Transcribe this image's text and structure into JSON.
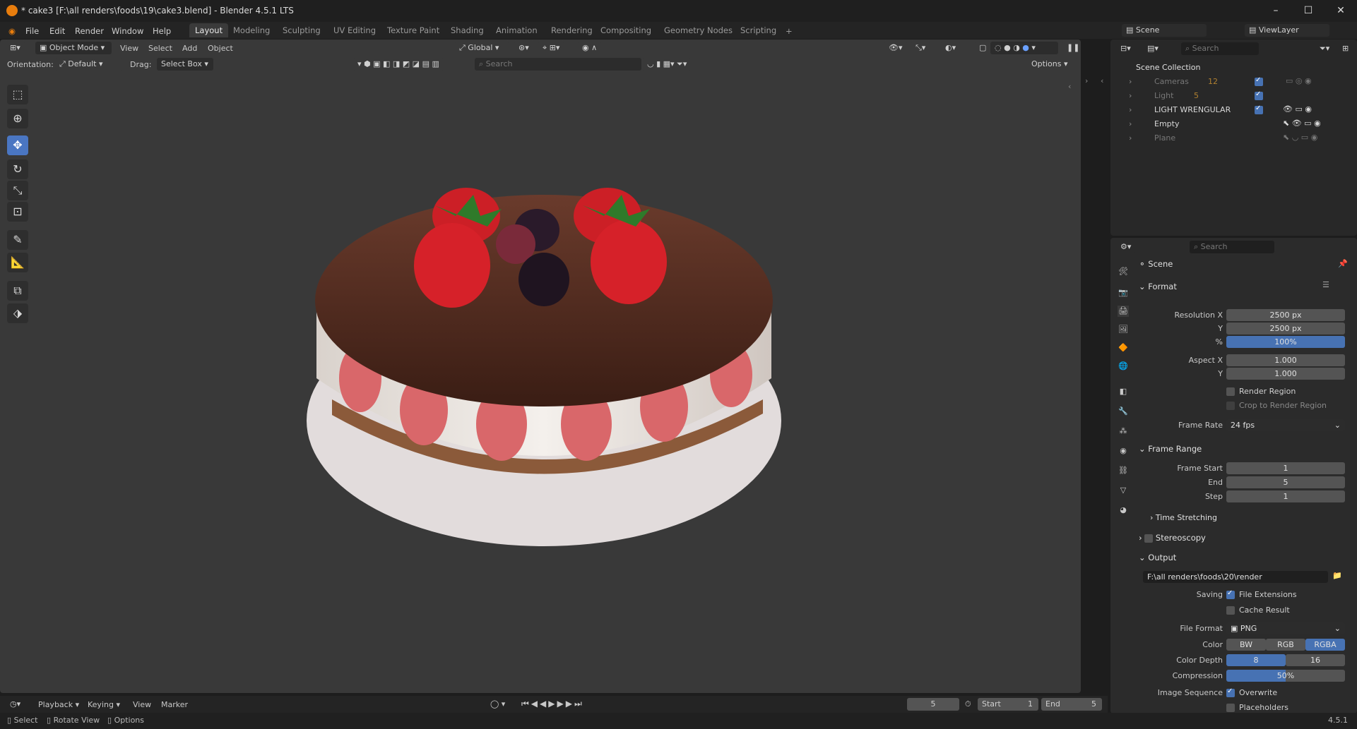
{
  "window": {
    "title": "* cake3 [F:\\all renders\\foods\\19\\cake3.blend] - Blender 4.5.1 LTS"
  },
  "menu": [
    "File",
    "Edit",
    "Render",
    "Window",
    "Help"
  ],
  "workspaces": [
    {
      "label": "Layout",
      "active": true
    },
    {
      "label": "Modeling"
    },
    {
      "label": "Sculpting"
    },
    {
      "label": "UV Editing"
    },
    {
      "label": "Texture Paint"
    },
    {
      "label": "Shading"
    },
    {
      "label": "Animation"
    },
    {
      "label": "Rendering"
    },
    {
      "label": "Compositing"
    },
    {
      "label": "Geometry Nodes"
    },
    {
      "label": "Scripting"
    }
  ],
  "viewport": {
    "mode": "Object Mode",
    "menu": [
      "View",
      "Select",
      "Add",
      "Object"
    ],
    "transform_orientation": "Global",
    "orientation_label": "Orientation:",
    "orientation_value": "Default",
    "drag_label": "Drag:",
    "drag_value": "Select Box",
    "search_placeholder": "Search",
    "options_label": "Options"
  },
  "scene_selector": {
    "scene": "Scene",
    "view_layer": "ViewLayer"
  },
  "outliner": {
    "search_placeholder": "Search",
    "root": "Scene Collection",
    "items": [
      {
        "name": "Cameras",
        "badge": "12",
        "dim": true
      },
      {
        "name": "Light",
        "badge": "5",
        "dim": true
      },
      {
        "name": "LIGHT WRENGULAR",
        "dim": false
      },
      {
        "name": "Empty",
        "dim": false
      },
      {
        "name": "Plane",
        "dim": true
      }
    ]
  },
  "properties": {
    "search_placeholder": "Search",
    "context": "Scene",
    "format": {
      "title": "Format",
      "res_x_label": "Resolution X",
      "res_x": "2500 px",
      "res_y_label": "Y",
      "res_y": "2500 px",
      "pct_label": "%",
      "pct": "100%",
      "aspect_x_label": "Aspect X",
      "aspect_x": "1.000",
      "aspect_y_label": "Y",
      "aspect_y": "1.000",
      "render_region": "Render Region",
      "crop_region": "Crop to Render Region",
      "frame_rate_label": "Frame Rate",
      "frame_rate": "24 fps"
    },
    "frame_range": {
      "title": "Frame Range",
      "start_label": "Frame Start",
      "start": "1",
      "end_label": "End",
      "end": "5",
      "step_label": "Step",
      "step": "1",
      "time_stretching": "Time Stretching"
    },
    "stereoscopy": "Stereoscopy",
    "output": {
      "title": "Output",
      "path": "F:\\all renders\\foods\\20\\render",
      "saving_label": "Saving",
      "file_extensions": "File Extensions",
      "cache_result": "Cache Result",
      "file_format_label": "File Format",
      "file_format": "PNG",
      "color_label": "Color",
      "color_opts": [
        "BW",
        "RGB",
        "RGBA"
      ],
      "depth_label": "Color Depth",
      "depth_opts": [
        "8",
        "16"
      ],
      "compression_label": "Compression",
      "compression": "50%",
      "image_sequence_label": "Image Sequence",
      "overwrite": "Overwrite",
      "placeholders": "Placeholders"
    }
  },
  "timeline": {
    "menu": [
      "Playback",
      "Keying",
      "View",
      "Marker"
    ],
    "current": "5",
    "start_label": "Start",
    "start": "1",
    "end_label": "End",
    "end": "5"
  },
  "statusbar": {
    "select": "Select",
    "rotate": "Rotate View",
    "options": "Options",
    "version": "4.5.1"
  },
  "colors": {
    "accent": "#4772b3",
    "active_tool": "#4a76c2",
    "brand": "#e87d0d"
  }
}
